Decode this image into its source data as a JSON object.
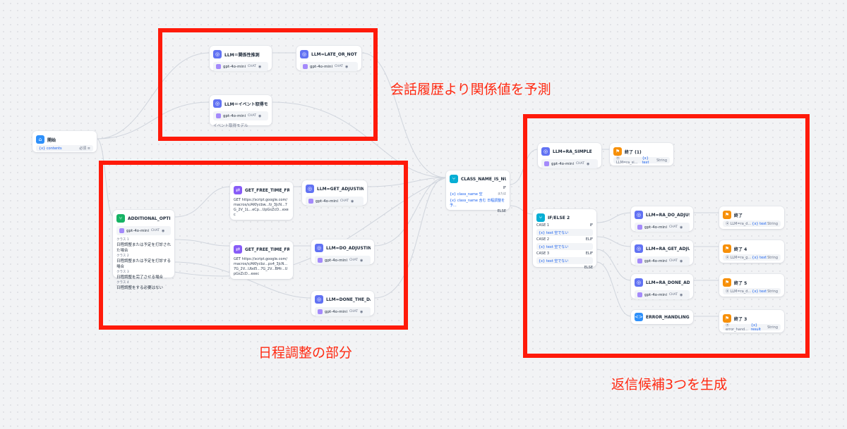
{
  "start": {
    "title": "開始",
    "var": "{x} contents",
    "req": "必須 ≡"
  },
  "llm_rel": {
    "title": "LLM＝関係性推測",
    "model": "gpt-4o-mini",
    "tag": "CHAT"
  },
  "llm_late": {
    "title": "LLM=LATE_OR_NOT",
    "model": "gpt-4o-mini",
    "tag": "CHAT"
  },
  "llm_event": {
    "title": "LLM＝イベント取得モデル",
    "model": "gpt-4o-mini",
    "tag": "CHAT",
    "desc": "イベント取得モデル"
  },
  "additional": {
    "title": "ADDITIONAL_OPTION",
    "model": "gpt-4o-mini",
    "tag": "CHAT",
    "classes": [
      {
        "label": "クラス 1",
        "text": "日程調整または予定を打診された場合"
      },
      {
        "label": "クラス 2",
        "text": "日程調整または予定を打診する場合"
      },
      {
        "label": "クラス 3",
        "text": "日程調整を完了させる場合"
      },
      {
        "label": "クラス 4",
        "text": "日程調整をする必要はない"
      }
    ]
  },
  "http1": {
    "title": "GET_FREE_TIME_FROM_...",
    "body": "GET  https://script.google.com/macros/s/AKfycbw...fz_3JcN...7G_2V_1L...eCp...UpGsZcD...exec"
  },
  "http2": {
    "title": "GET_FREE_TIME_FROM_...",
    "body": "GET  https://script.google.com/macros/s/AKfycbz...ps4_3JcN...7G_2V...Ubd5...7G_2V...BMr...UpGsZcD...exec"
  },
  "llm_getadj": {
    "title": "LLM=GET_ADJUSTING_D...",
    "model": "gpt-4o-mini",
    "tag": "CHAT"
  },
  "llm_doadj": {
    "title": "LLM=DO_ADJUSTING_DA...",
    "model": "gpt-4o-mini",
    "tag": "CHAT"
  },
  "llm_done": {
    "title": "LLM=DONE_THE_DATE_...",
    "model": "gpt-4o-mini",
    "tag": "CHAT"
  },
  "classnull": {
    "title": "CLASS_NAME_IS_NULL",
    "if": "IF",
    "else": "ELSE",
    "cond1": "{x} class_name 空",
    "and": "または",
    "cond2": "{x} class_name 含む 日程調整を予..."
  },
  "llm_simple": {
    "title": "LLM=RA_SIMPLE",
    "model": "gpt-4o-mini",
    "tag": "CHAT"
  },
  "end1": {
    "title": "終了 (1)",
    "var": "⦿ LLM=ra_si...",
    "var2": "{x} text",
    "type": "String"
  },
  "ifelse2": {
    "title": "IF/ELSE 2",
    "cases": [
      {
        "label": "CASE 1",
        "kind": "IF",
        "cond": "{x} text 空でない"
      },
      {
        "label": "CASE 2",
        "kind": "ELIF",
        "cond": "{x} text 空でない"
      },
      {
        "label": "CASE 3",
        "kind": "ELIF",
        "cond": "{x} text 空でない"
      }
    ],
    "else": "ELSE"
  },
  "llm_ra_do": {
    "title": "LLM=RA_DO_ADJUST_DA...",
    "model": "gpt-4o-mini",
    "tag": "CHAT"
  },
  "llm_ra_get": {
    "title": "LLM=RA_GET_ADJUST_D...",
    "model": "gpt-4o-mini",
    "tag": "CHAT"
  },
  "llm_ra_done": {
    "title": "LLM=RA_DONE_ADJUST_...",
    "model": "gpt-4o-mini",
    "tag": "CHAT"
  },
  "error": {
    "title": "ERROR_HANDLING"
  },
  "end2": {
    "title": "終了",
    "var": "⦿ LLM=ra_d...",
    "var2": "{x} text",
    "type": "String"
  },
  "end4": {
    "title": "終了 4",
    "var": "⦿ LLM=ra_g...",
    "var2": "{x} text",
    "type": "String"
  },
  "end5": {
    "title": "終了 5",
    "var": "⦿ LLM=ra_d...",
    "var2": "{x} text",
    "type": "String"
  },
  "end3": {
    "title": "終了 3",
    "var": "⦿ error_hand...",
    "var2": "{x} result",
    "type": "String"
  },
  "annotations": {
    "a1": "会話履歴より関係値を予測",
    "a2": "日程調整の部分",
    "a3": "返信候補3つを生成"
  },
  "colors": {
    "red": "#ff1a0a",
    "llm": "#6172f3",
    "end": "#f79009",
    "http": "#875bf7",
    "ifelse": "#06aed4"
  }
}
